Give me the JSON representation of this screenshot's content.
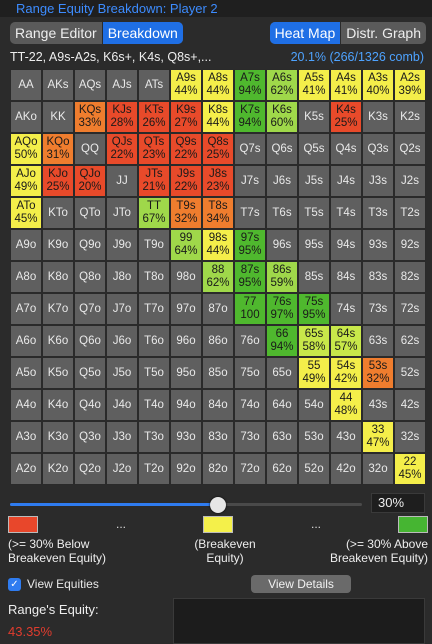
{
  "title": "Range Equity Breakdown: Player 2",
  "tabs_left": [
    {
      "label": "Range Editor",
      "active": false
    },
    {
      "label": "Breakdown",
      "active": true
    }
  ],
  "tabs_right": [
    {
      "label": "Heat Map",
      "active": true
    },
    {
      "label": "Distr. Graph",
      "active": false
    }
  ],
  "range_text": "TT-22, A9s-A2s, K6s+, K4s, Q8s+,...",
  "range_stat": "20.1%  (266/1326 comb)",
  "colors": {
    "red": "#e84a2a",
    "orange": "#ef7d2e",
    "yellow": "#f4ee4a",
    "yellowgreen": "#c8e84a",
    "lightgreen": "#9fd84a",
    "green": "#4fb82e",
    "gray": "#5f5f5f"
  },
  "grid": [
    [
      {
        "h": "AA"
      },
      {
        "h": "AKs"
      },
      {
        "h": "AQs"
      },
      {
        "h": "AJs"
      },
      {
        "h": "ATs"
      },
      {
        "h": "A9s",
        "e": "44%",
        "c": "yellow"
      },
      {
        "h": "A8s",
        "e": "44%",
        "c": "yellow"
      },
      {
        "h": "A7s",
        "e": "94%",
        "c": "green"
      },
      {
        "h": "A6s",
        "e": "62%",
        "c": "lightgreen"
      },
      {
        "h": "A5s",
        "e": "41%",
        "c": "yellow"
      },
      {
        "h": "A4s",
        "e": "41%",
        "c": "yellow"
      },
      {
        "h": "A3s",
        "e": "40%",
        "c": "yellow"
      },
      {
        "h": "A2s",
        "e": "39%",
        "c": "yellow"
      }
    ],
    [
      {
        "h": "AKo"
      },
      {
        "h": "KK"
      },
      {
        "h": "KQs",
        "e": "33%",
        "c": "orange"
      },
      {
        "h": "KJs",
        "e": "28%",
        "c": "red"
      },
      {
        "h": "KTs",
        "e": "26%",
        "c": "red"
      },
      {
        "h": "K9s",
        "e": "27%",
        "c": "red"
      },
      {
        "h": "K8s",
        "e": "44%",
        "c": "yellow"
      },
      {
        "h": "K7s",
        "e": "94%",
        "c": "green"
      },
      {
        "h": "K6s",
        "e": "60%",
        "c": "lightgreen"
      },
      {
        "h": "K5s"
      },
      {
        "h": "K4s",
        "e": "25%",
        "c": "red"
      },
      {
        "h": "K3s"
      },
      {
        "h": "K2s"
      }
    ],
    [
      {
        "h": "AQo",
        "e": "50%",
        "c": "yellow"
      },
      {
        "h": "KQo",
        "e": "31%",
        "c": "orange"
      },
      {
        "h": "QQ"
      },
      {
        "h": "QJs",
        "e": "22%",
        "c": "red"
      },
      {
        "h": "QTs",
        "e": "23%",
        "c": "red"
      },
      {
        "h": "Q9s",
        "e": "22%",
        "c": "red"
      },
      {
        "h": "Q8s",
        "e": "25%",
        "c": "red"
      },
      {
        "h": "Q7s"
      },
      {
        "h": "Q6s"
      },
      {
        "h": "Q5s"
      },
      {
        "h": "Q4s"
      },
      {
        "h": "Q3s"
      },
      {
        "h": "Q2s"
      }
    ],
    [
      {
        "h": "AJo",
        "e": "49%",
        "c": "yellow"
      },
      {
        "h": "KJo",
        "e": "25%",
        "c": "red"
      },
      {
        "h": "QJo",
        "e": "20%",
        "c": "red"
      },
      {
        "h": "JJ"
      },
      {
        "h": "JTs",
        "e": "21%",
        "c": "red"
      },
      {
        "h": "J9s",
        "e": "22%",
        "c": "red"
      },
      {
        "h": "J8s",
        "e": "23%",
        "c": "red"
      },
      {
        "h": "J7s"
      },
      {
        "h": "J6s"
      },
      {
        "h": "J5s"
      },
      {
        "h": "J4s"
      },
      {
        "h": "J3s"
      },
      {
        "h": "J2s"
      }
    ],
    [
      {
        "h": "ATo",
        "e": "45%",
        "c": "yellow"
      },
      {
        "h": "KTo"
      },
      {
        "h": "QTo"
      },
      {
        "h": "JTo"
      },
      {
        "h": "TT",
        "e": "67%",
        "c": "lightgreen"
      },
      {
        "h": "T9s",
        "e": "32%",
        "c": "orange"
      },
      {
        "h": "T8s",
        "e": "34%",
        "c": "orange"
      },
      {
        "h": "T7s"
      },
      {
        "h": "T6s"
      },
      {
        "h": "T5s"
      },
      {
        "h": "T4s"
      },
      {
        "h": "T3s"
      },
      {
        "h": "T2s"
      }
    ],
    [
      {
        "h": "A9o"
      },
      {
        "h": "K9o"
      },
      {
        "h": "Q9o"
      },
      {
        "h": "J9o"
      },
      {
        "h": "T9o"
      },
      {
        "h": "99",
        "e": "64%",
        "c": "lightgreen"
      },
      {
        "h": "98s",
        "e": "44%",
        "c": "yellow"
      },
      {
        "h": "97s",
        "e": "95%",
        "c": "green"
      },
      {
        "h": "96s"
      },
      {
        "h": "95s"
      },
      {
        "h": "94s"
      },
      {
        "h": "93s"
      },
      {
        "h": "92s"
      }
    ],
    [
      {
        "h": "A8o"
      },
      {
        "h": "K8o"
      },
      {
        "h": "Q8o"
      },
      {
        "h": "J8o"
      },
      {
        "h": "T8o"
      },
      {
        "h": "98o"
      },
      {
        "h": "88",
        "e": "62%",
        "c": "lightgreen"
      },
      {
        "h": "87s",
        "e": "95%",
        "c": "green"
      },
      {
        "h": "86s",
        "e": "59%",
        "c": "lightgreen"
      },
      {
        "h": "85s"
      },
      {
        "h": "84s"
      },
      {
        "h": "83s"
      },
      {
        "h": "82s"
      }
    ],
    [
      {
        "h": "A7o"
      },
      {
        "h": "K7o"
      },
      {
        "h": "Q7o"
      },
      {
        "h": "J7o"
      },
      {
        "h": "T7o"
      },
      {
        "h": "97o"
      },
      {
        "h": "87o"
      },
      {
        "h": "77",
        "e": "100",
        "c": "green"
      },
      {
        "h": "76s",
        "e": "97%",
        "c": "green"
      },
      {
        "h": "75s",
        "e": "95%",
        "c": "green"
      },
      {
        "h": "74s"
      },
      {
        "h": "73s"
      },
      {
        "h": "72s"
      }
    ],
    [
      {
        "h": "A6o"
      },
      {
        "h": "K6o"
      },
      {
        "h": "Q6o"
      },
      {
        "h": "J6o"
      },
      {
        "h": "T6o"
      },
      {
        "h": "96o"
      },
      {
        "h": "86o"
      },
      {
        "h": "76o"
      },
      {
        "h": "66",
        "e": "94%",
        "c": "green"
      },
      {
        "h": "65s",
        "e": "58%",
        "c": "yellowgreen"
      },
      {
        "h": "64s",
        "e": "57%",
        "c": "yellowgreen"
      },
      {
        "h": "63s"
      },
      {
        "h": "62s"
      }
    ],
    [
      {
        "h": "A5o"
      },
      {
        "h": "K5o"
      },
      {
        "h": "Q5o"
      },
      {
        "h": "J5o"
      },
      {
        "h": "T5o"
      },
      {
        "h": "95o"
      },
      {
        "h": "85o"
      },
      {
        "h": "75o"
      },
      {
        "h": "65o"
      },
      {
        "h": "55",
        "e": "49%",
        "c": "yellow"
      },
      {
        "h": "54s",
        "e": "42%",
        "c": "yellow"
      },
      {
        "h": "53s",
        "e": "32%",
        "c": "orange"
      },
      {
        "h": "52s"
      }
    ],
    [
      {
        "h": "A4o"
      },
      {
        "h": "K4o"
      },
      {
        "h": "Q4o"
      },
      {
        "h": "J4o"
      },
      {
        "h": "T4o"
      },
      {
        "h": "94o"
      },
      {
        "h": "84o"
      },
      {
        "h": "74o"
      },
      {
        "h": "64o"
      },
      {
        "h": "54o"
      },
      {
        "h": "44",
        "e": "48%",
        "c": "yellow"
      },
      {
        "h": "43s"
      },
      {
        "h": "42s"
      }
    ],
    [
      {
        "h": "A3o"
      },
      {
        "h": "K3o"
      },
      {
        "h": "Q3o"
      },
      {
        "h": "J3o"
      },
      {
        "h": "T3o"
      },
      {
        "h": "93o"
      },
      {
        "h": "83o"
      },
      {
        "h": "73o"
      },
      {
        "h": "63o"
      },
      {
        "h": "53o"
      },
      {
        "h": "43o"
      },
      {
        "h": "33",
        "e": "47%",
        "c": "yellow"
      },
      {
        "h": "32s"
      }
    ],
    [
      {
        "h": "A2o"
      },
      {
        "h": "K2o"
      },
      {
        "h": "Q2o"
      },
      {
        "h": "J2o"
      },
      {
        "h": "T2o"
      },
      {
        "h": "92o"
      },
      {
        "h": "82o"
      },
      {
        "h": "72o"
      },
      {
        "h": "62o"
      },
      {
        "h": "52o"
      },
      {
        "h": "42o"
      },
      {
        "h": "32o"
      },
      {
        "h": "22",
        "e": "45%",
        "c": "yellow"
      }
    ]
  ],
  "slider": {
    "value_fraction": 0.59,
    "percent_label": "30%"
  },
  "legend": {
    "below_color": "#e8472b",
    "breakeven_color": "#f4f04a",
    "above_color": "#46b532",
    "dots": "...",
    "below_label": "(>= 30% Below Breakeven Equity)",
    "breakeven_label": "(Breakeven Equity)",
    "above_label": "(>= 30% Above Breakeven Equity)"
  },
  "view_equities": {
    "label": "View Equities",
    "checked": true
  },
  "view_details_label": "View Details",
  "range_equity_label": "Range's Equity:",
  "range_equity_value": "43.35%"
}
